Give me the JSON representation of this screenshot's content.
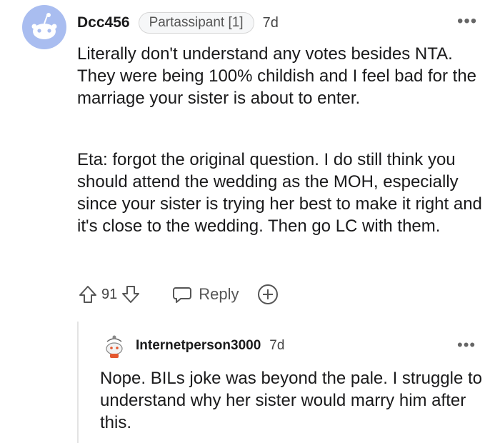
{
  "comment": {
    "username": "Dcc456",
    "flair": "Partassipant [1]",
    "time": "7d",
    "paragraphs": [
      "Literally don't understand any votes besides NTA. They were being 100% childish and I feel bad for the marriage your sister is about to enter.",
      "Eta: forgot the original question. I do still think you should attend the wedding as the MOH, especially since your sister is trying her best to make it right and it's close to the wedding. Then go LC with them."
    ],
    "score": "91",
    "reply_label": "Reply",
    "more_label": "•••"
  },
  "reply": {
    "username": "Internetperson3000",
    "time": "7d",
    "text": "Nope. BILs joke was beyond the pale. I struggle to understand why her sister would marry him after this.",
    "more_label": "•••"
  },
  "colors": {
    "avatar_bg": "#a9bdf0",
    "text": "#1a1a1b",
    "muted": "#555555",
    "thread_line": "#e3e3e3"
  }
}
